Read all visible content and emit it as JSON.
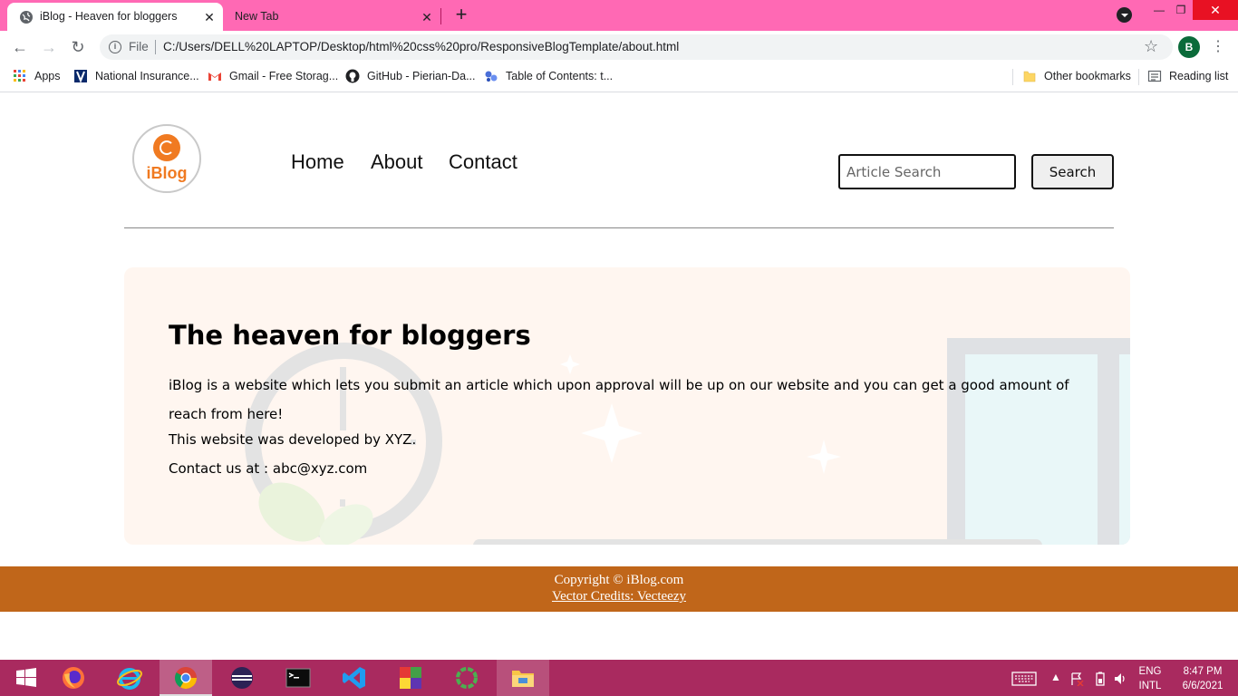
{
  "browser": {
    "tabs": [
      {
        "title": "iBlog - Heaven for bloggers",
        "active": true
      },
      {
        "title": "New Tab",
        "active": false
      }
    ],
    "new_tab_glyph": "+",
    "close_glyph": "✕",
    "window_controls": {
      "minimize": "—",
      "maximize": "❐",
      "close": "✕"
    },
    "nav": {
      "back": "←",
      "forward": "→",
      "reload": "↻"
    },
    "omnibox": {
      "info_glyph": "i",
      "scheme_label": "File",
      "url": "C:/Users/DELL%20LAPTOP/Desktop/html%20css%20pro/ResponsiveBlogTemplate/about.html",
      "star_glyph": "☆"
    },
    "profile_initial": "B",
    "menu_glyph": "⋮",
    "bookmarks": [
      {
        "label": "Apps",
        "icon": "apps-grid-icon"
      },
      {
        "label": "National Insurance...",
        "icon": "insurance-icon"
      },
      {
        "label": "Gmail - Free Storag...",
        "icon": "gmail-icon"
      },
      {
        "label": "GitHub - Pierian-Da...",
        "icon": "github-icon"
      },
      {
        "label": "Table of Contents: t...",
        "icon": "toc-icon"
      }
    ],
    "other_bookmarks": "Other bookmarks",
    "reading_list": "Reading list"
  },
  "site": {
    "logo_text": "iBlog",
    "nav_links": [
      "Home",
      "About",
      "Contact"
    ],
    "search": {
      "placeholder": "Article Search",
      "value": "",
      "button": "Search"
    },
    "hero": {
      "title": "The heaven for bloggers",
      "text1": "iBlog is a website which lets you submit an article which upon approval will be up on our website and you can get a good amount of reach from here!",
      "text2": "This website was developed by XYZ.",
      "text3": "Contact us at : abc@xyz.com"
    },
    "footer": {
      "copyright": "Copyright © iBlog.com",
      "credits": "Vector Credits: Vecteezy"
    },
    "colors": {
      "accent": "#f07a21",
      "footer": "#c0661a",
      "hero_bg": "#fff6f0"
    }
  },
  "taskbar": {
    "apps": [
      "start-icon",
      "firefox-icon",
      "internet-explorer-icon",
      "chrome-icon",
      "eclipse-icon",
      "terminal-icon",
      "vscode-icon",
      "winrar-icon",
      "cortana-ring-icon",
      "file-explorer-icon"
    ],
    "language": "ENG",
    "layout": "INTL",
    "time": "8:47 PM",
    "date": "6/6/2021",
    "colors": {
      "bar": "#a92a5f"
    }
  }
}
